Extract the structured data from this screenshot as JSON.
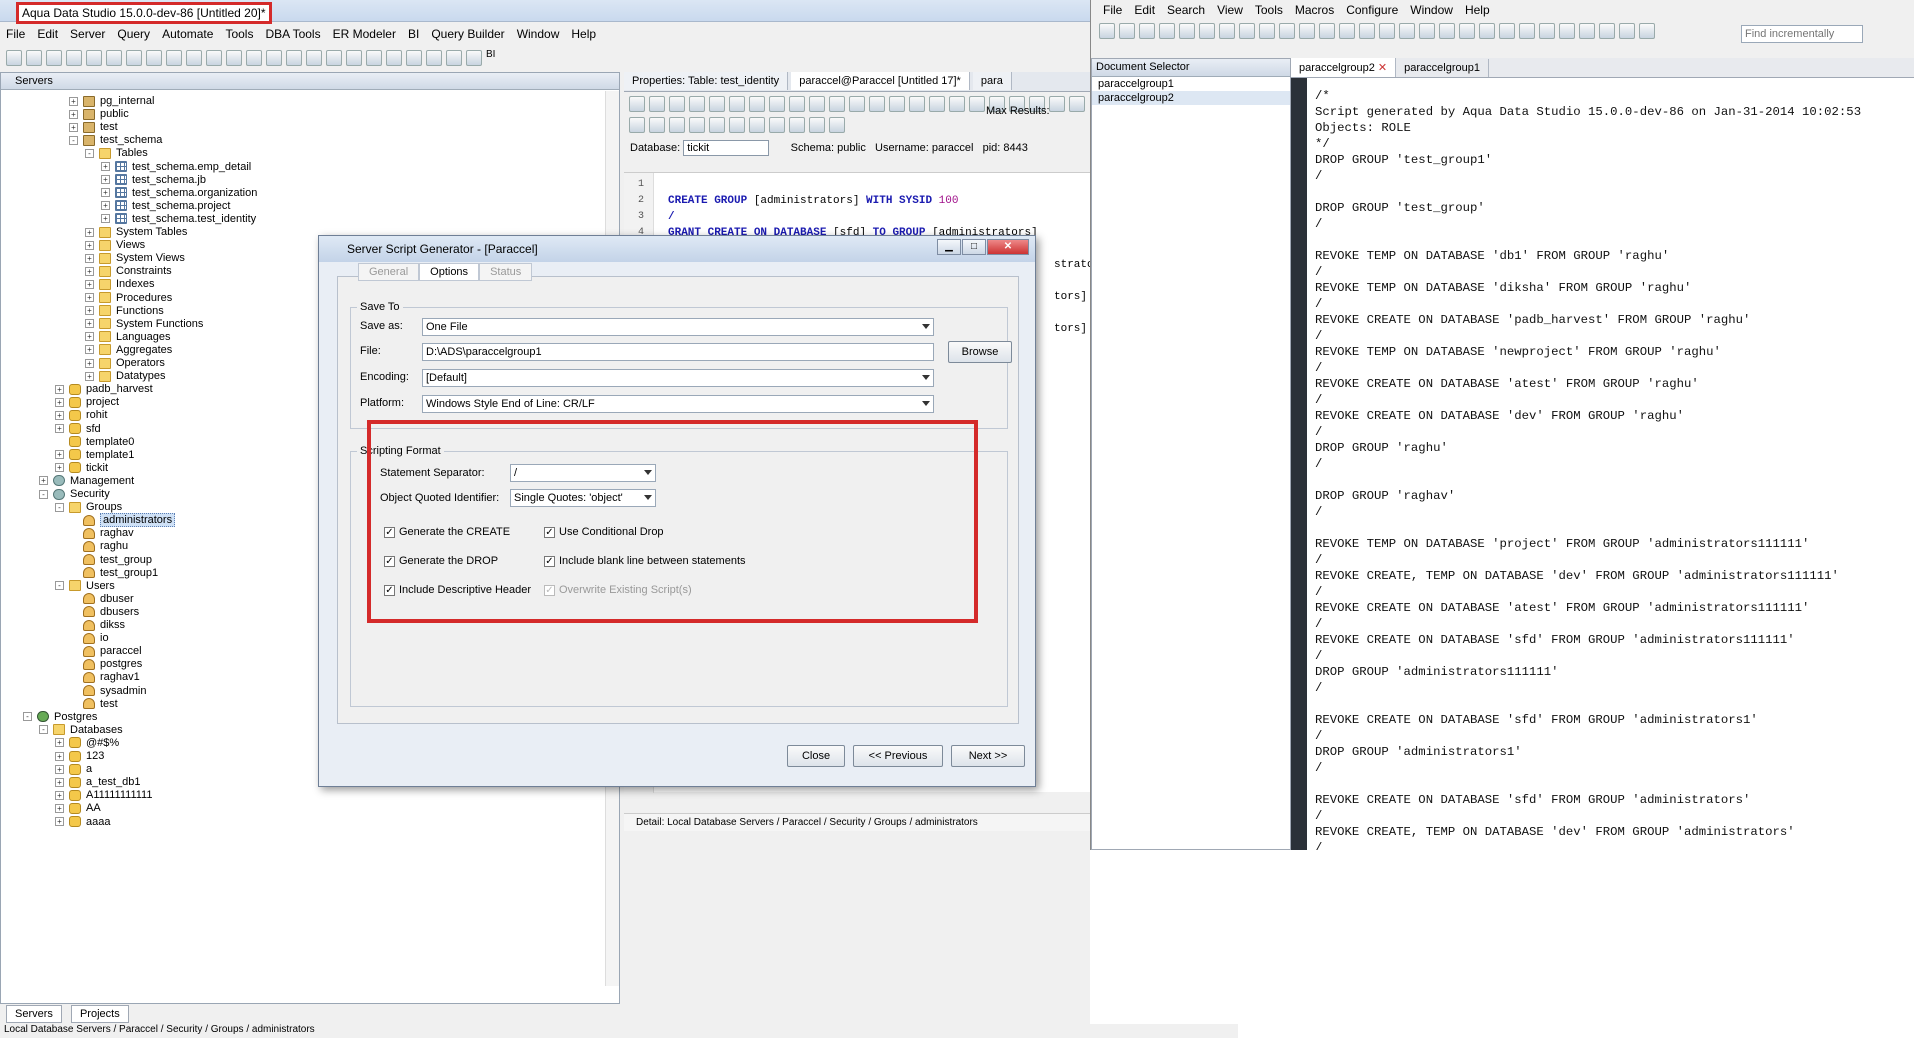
{
  "left_app": {
    "title": "Aqua Data Studio 15.0.0-dev-86 [Untitled 20]*",
    "menu": [
      "File",
      "Edit",
      "Server",
      "Query",
      "Automate",
      "Tools",
      "DBA Tools",
      "ER Modeler",
      "BI",
      "Query Builder",
      "Window",
      "Help"
    ],
    "toolbar_bi": "BI",
    "servers_panel": {
      "title": "Servers",
      "tree": [
        {
          "label": "pg_internal",
          "level": 4,
          "icon": "schema",
          "toggle": "+"
        },
        {
          "label": "public",
          "level": 4,
          "icon": "schema",
          "toggle": "+"
        },
        {
          "label": "test",
          "level": 4,
          "icon": "schema",
          "toggle": "+"
        },
        {
          "label": "test_schema",
          "level": 4,
          "icon": "schema",
          "toggle": "-"
        },
        {
          "label": "Tables",
          "level": 5,
          "icon": "folder",
          "toggle": "-"
        },
        {
          "label": "test_schema.emp_detail",
          "level": 6,
          "icon": "table",
          "toggle": "+"
        },
        {
          "label": "test_schema.jb",
          "level": 6,
          "icon": "table",
          "toggle": "+"
        },
        {
          "label": "test_schema.organization",
          "level": 6,
          "icon": "table",
          "toggle": "+"
        },
        {
          "label": "test_schema.project",
          "level": 6,
          "icon": "table",
          "toggle": "+"
        },
        {
          "label": "test_schema.test_identity",
          "level": 6,
          "icon": "table",
          "toggle": "+"
        },
        {
          "label": "System Tables",
          "level": 5,
          "icon": "folder",
          "toggle": "+"
        },
        {
          "label": "Views",
          "level": 5,
          "icon": "folder",
          "toggle": "+"
        },
        {
          "label": "System Views",
          "level": 5,
          "icon": "folder",
          "toggle": "+"
        },
        {
          "label": "Constraints",
          "level": 5,
          "icon": "folder",
          "toggle": "+"
        },
        {
          "label": "Indexes",
          "level": 5,
          "icon": "folder",
          "toggle": "+"
        },
        {
          "label": "Procedures",
          "level": 5,
          "icon": "folder",
          "toggle": "+"
        },
        {
          "label": "Functions",
          "level": 5,
          "icon": "folder",
          "toggle": "+"
        },
        {
          "label": "System Functions",
          "level": 5,
          "icon": "folder",
          "toggle": "+"
        },
        {
          "label": "Languages",
          "level": 5,
          "icon": "folder",
          "toggle": "+"
        },
        {
          "label": "Aggregates",
          "level": 5,
          "icon": "folder",
          "toggle": "+"
        },
        {
          "label": "Operators",
          "level": 5,
          "icon": "folder",
          "toggle": "+"
        },
        {
          "label": "Datatypes",
          "level": 5,
          "icon": "folder",
          "toggle": "+"
        },
        {
          "label": "padb_harvest",
          "level": 3,
          "icon": "db",
          "toggle": "+"
        },
        {
          "label": "project",
          "level": 3,
          "icon": "db",
          "toggle": "+"
        },
        {
          "label": "rohit",
          "level": 3,
          "icon": "db",
          "toggle": "+"
        },
        {
          "label": "sfd",
          "level": 3,
          "icon": "db",
          "toggle": "+"
        },
        {
          "label": "template0",
          "level": 3,
          "icon": "db",
          "toggle": ""
        },
        {
          "label": "template1",
          "level": 3,
          "icon": "db",
          "toggle": "+"
        },
        {
          "label": "tickit",
          "level": 3,
          "icon": "db",
          "toggle": "+"
        },
        {
          "label": "Management",
          "level": 2,
          "icon": "gear",
          "toggle": "+"
        },
        {
          "label": "Security",
          "level": 2,
          "icon": "gear",
          "toggle": "-"
        },
        {
          "label": "Groups",
          "level": 3,
          "icon": "folder",
          "toggle": "-"
        },
        {
          "label": "administrators",
          "level": 4,
          "icon": "user",
          "toggle": "",
          "selected": true
        },
        {
          "label": "raghav",
          "level": 4,
          "icon": "user",
          "toggle": ""
        },
        {
          "label": "raghu",
          "level": 4,
          "icon": "user",
          "toggle": ""
        },
        {
          "label": "test_group",
          "level": 4,
          "icon": "user",
          "toggle": ""
        },
        {
          "label": "test_group1",
          "level": 4,
          "icon": "user",
          "toggle": ""
        },
        {
          "label": "Users",
          "level": 3,
          "icon": "folder",
          "toggle": "-"
        },
        {
          "label": "dbuser",
          "level": 4,
          "icon": "user",
          "toggle": ""
        },
        {
          "label": "dbusers",
          "level": 4,
          "icon": "user",
          "toggle": ""
        },
        {
          "label": "dikss",
          "level": 4,
          "icon": "user",
          "toggle": ""
        },
        {
          "label": "io",
          "level": 4,
          "icon": "user",
          "toggle": ""
        },
        {
          "label": "paraccel",
          "level": 4,
          "icon": "user",
          "toggle": ""
        },
        {
          "label": "postgres",
          "level": 4,
          "icon": "user",
          "toggle": ""
        },
        {
          "label": "raghav1",
          "level": 4,
          "icon": "user",
          "toggle": ""
        },
        {
          "label": "sysadmin",
          "level": 4,
          "icon": "user",
          "toggle": ""
        },
        {
          "label": "test",
          "level": 4,
          "icon": "user",
          "toggle": ""
        },
        {
          "label": "Postgres",
          "level": 1,
          "icon": "server",
          "toggle": "-"
        },
        {
          "label": "Databases",
          "level": 2,
          "icon": "folder",
          "toggle": "-"
        },
        {
          "label": "@#$%",
          "level": 3,
          "icon": "db",
          "toggle": "+"
        },
        {
          "label": "123",
          "level": 3,
          "icon": "db",
          "toggle": "+"
        },
        {
          "label": "a",
          "level": 3,
          "icon": "db",
          "toggle": "+"
        },
        {
          "label": "a_test_db1",
          "level": 3,
          "icon": "db",
          "toggle": "+"
        },
        {
          "label": "A11111111111",
          "level": 3,
          "icon": "db",
          "toggle": "+"
        },
        {
          "label": "AA",
          "level": 3,
          "icon": "db",
          "toggle": "+"
        },
        {
          "label": "aaaa",
          "level": 3,
          "icon": "db",
          "toggle": "+"
        }
      ]
    },
    "bottom_tabs": [
      "Servers",
      "Projects"
    ],
    "status": "Local Database Servers / Paraccel / Security / Groups / administrators"
  },
  "editor": {
    "tabs": [
      "Properties: Table: test_identity",
      "paraccel@Paraccel [Untitled 17]*",
      "para"
    ],
    "max_results_label": "Max Results:",
    "database_label": "Database:",
    "database_value": "tickit",
    "schema_text": "Schema: public",
    "username_text": "Username: paraccel",
    "pid_text": "pid: 8443",
    "lines": [
      "1",
      "2",
      "3",
      "4"
    ],
    "code": {
      "l2_kw1": "CREATE GROUP",
      "l2_t1": " [administrators] ",
      "l2_kw2": "WITH SYSID",
      "l2_num": " 100",
      "l3": "/",
      "l4_kw1": "GRANT CREATE ON DATABASE",
      "l4_t1": " [sfd] ",
      "l4_kw2": "TO GROUP",
      "l4_t2": " [administrators]"
    },
    "hidden_tails": [
      "strator",
      "tors]",
      "tors]"
    ],
    "detail": "Detail: Local Database Servers / Paraccel / Security / Groups / administrators"
  },
  "dialog": {
    "title": "Server Script Generator - [Paraccel]",
    "tabs": [
      "General",
      "Options",
      "Status"
    ],
    "save_to_legend": "Save To",
    "save_as_label": "Save as:",
    "save_as_value": "One File",
    "file_label": "File:",
    "file_value": "D:\\ADS\\paraccelgroup1",
    "browse": "Browse",
    "encoding_label": "Encoding:",
    "encoding_value": "[Default]",
    "platform_label": "Platform:",
    "platform_value": "Windows Style End of Line: CR/LF",
    "scripting_legend": "Scripting Format",
    "separator_label": "Statement Separator:",
    "separator_value": "/",
    "quoted_label": "Object Quoted Identifier:",
    "quoted_value": "Single Quotes: 'object'",
    "checks": {
      "gen_create": "Generate the CREATE",
      "gen_drop": "Generate the DROP",
      "desc_header": "Include Descriptive Header",
      "cond_drop": "Use Conditional Drop",
      "blank_line": "Include blank line between statements",
      "overwrite": "Overwrite Existing Script(s)"
    },
    "close": "Close",
    "previous": "<< Previous",
    "next": "Next >>"
  },
  "right_app": {
    "menu": [
      "File",
      "Edit",
      "Search",
      "View",
      "Tools",
      "Macros",
      "Configure",
      "Window",
      "Help"
    ],
    "find_placeholder": "Find incrementally",
    "doc_selector_title": "Document Selector",
    "doc_items": [
      "paraccelgroup1",
      "paraccelgroup2"
    ],
    "tabs": [
      "paraccelgroup2",
      "paraccelgroup1"
    ],
    "script": "/*\nScript generated by Aqua Data Studio 15.0.0-dev-86 on Jan-31-2014 10:02:53\nObjects: ROLE\n*/\nDROP GROUP 'test_group1'\n/\n\nDROP GROUP 'test_group'\n/\n\nREVOKE TEMP ON DATABASE 'db1' FROM GROUP 'raghu'\n/\nREVOKE TEMP ON DATABASE 'diksha' FROM GROUP 'raghu'\n/\nREVOKE CREATE ON DATABASE 'padb_harvest' FROM GROUP 'raghu'\n/\nREVOKE TEMP ON DATABASE 'newproject' FROM GROUP 'raghu'\n/\nREVOKE CREATE ON DATABASE 'atest' FROM GROUP 'raghu'\n/\nREVOKE CREATE ON DATABASE 'dev' FROM GROUP 'raghu'\n/\nDROP GROUP 'raghu'\n/\n\nDROP GROUP 'raghav'\n/\n\nREVOKE TEMP ON DATABASE 'project' FROM GROUP 'administrators111111'\n/\nREVOKE CREATE, TEMP ON DATABASE 'dev' FROM GROUP 'administrators111111'\n/\nREVOKE CREATE ON DATABASE 'atest' FROM GROUP 'administrators111111'\n/\nREVOKE CREATE ON DATABASE 'sfd' FROM GROUP 'administrators111111'\n/\nDROP GROUP 'administrators111111'\n/\n\nREVOKE CREATE ON DATABASE 'sfd' FROM GROUP 'administrators1'\n/\nDROP GROUP 'administrators1'\n/\n\nREVOKE CREATE ON DATABASE 'sfd' FROM GROUP 'administrators'\n/\nREVOKE CREATE, TEMP ON DATABASE 'dev' FROM GROUP 'administrators'\n/"
  }
}
